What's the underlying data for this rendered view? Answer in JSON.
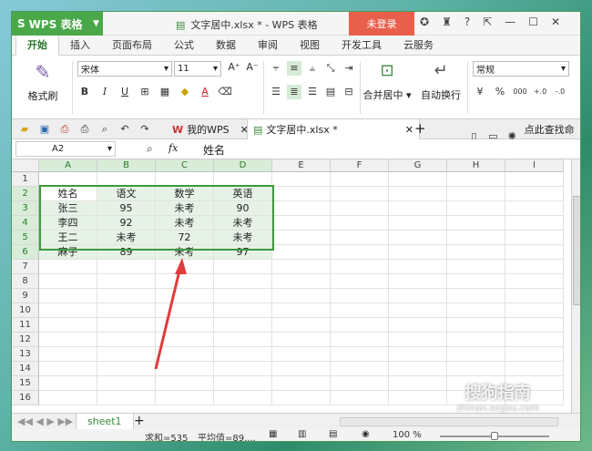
{
  "app": {
    "logo_text": "WPS 表格",
    "file_title": "文字居中.xlsx * - WPS 表格",
    "login": "未登录"
  },
  "ribbon_tabs": [
    "开始",
    "插入",
    "页面布局",
    "公式",
    "数据",
    "审阅",
    "视图",
    "开发工具",
    "云服务"
  ],
  "ribbon": {
    "format_painter": "格式刷",
    "font_name": "宋体",
    "font_size": "11",
    "bold": "B",
    "italic": "I",
    "underline": "U",
    "merge_center": "合并居中",
    "wrap_text": "自动换行",
    "number_format": "常规",
    "percent": "%",
    "thousands": "000"
  },
  "doc_tabs": {
    "mywps": "我的WPS",
    "file": "文字居中.xlsx *",
    "search": "点此查找命令"
  },
  "formula_bar": {
    "name_box": "A2",
    "fx": "fx",
    "content": "姓名"
  },
  "columns": [
    "A",
    "B",
    "C",
    "D",
    "E",
    "F",
    "G",
    "H",
    "I"
  ],
  "rows": [
    "1",
    "2",
    "3",
    "4",
    "5",
    "6",
    "7",
    "8",
    "9",
    "10",
    "11",
    "12",
    "13",
    "14",
    "15",
    "16"
  ],
  "table": [
    [
      "姓名",
      "语文",
      "数学",
      "英语"
    ],
    [
      "张三",
      "95",
      "未考",
      "90"
    ],
    [
      "李四",
      "92",
      "未考",
      "未考"
    ],
    [
      "王二",
      "未考",
      "72",
      "未考"
    ],
    [
      "麻子",
      "89",
      "未考",
      "97"
    ]
  ],
  "sheet": {
    "name": "sheet1",
    "add": "+"
  },
  "status": {
    "sum": "求和=535",
    "avg": "平均值=89....",
    "zoom": "100 %"
  },
  "watermark": "搜狗指南",
  "watermark_url": "zhinan.sogou.com",
  "colors": {
    "accent": "#4aa84a",
    "login": "#e8604c",
    "selection": "#3c9a3c",
    "arrow": "#e03c3c"
  }
}
